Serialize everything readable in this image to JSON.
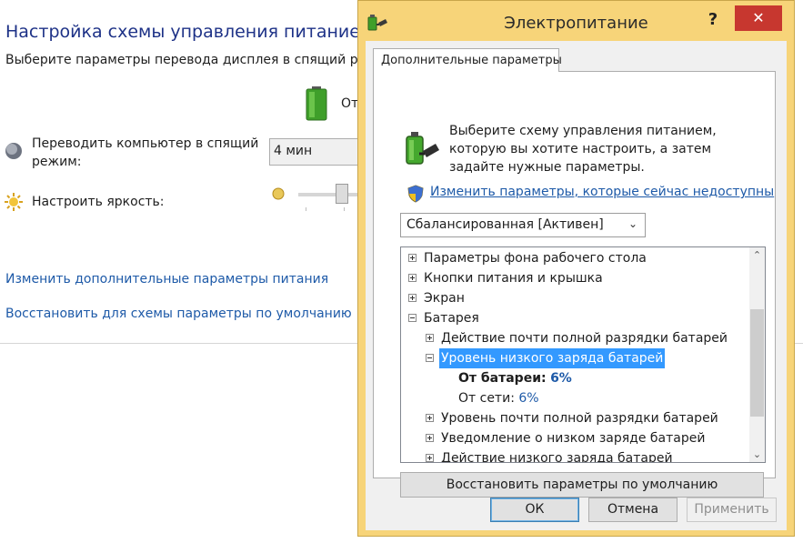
{
  "background": {
    "title": "Настройка схемы управления питанием \"С",
    "subtitle": "Выберите параметры перевода дисплея в спящий реж",
    "plan_column_label": "От",
    "sleep_label": "Переводить компьютер в спящий режим:",
    "sleep_value": "4 мин",
    "brightness_label": "Настроить яркость:",
    "brightness_level_fraction": 0.6,
    "link_advanced": "Изменить дополнительные параметры питания",
    "link_restore": "Восстановить для схемы параметры по умолчанию"
  },
  "dialog": {
    "title": "Электропитание",
    "help_label": "?",
    "close_label": "✕",
    "tab_label": "Дополнительные параметры",
    "description": "Выберите схему управления питанием, которую вы хотите настроить, а затем задайте нужные параметры.",
    "admin_link": "Изменить параметры, которые сейчас недоступны",
    "plan_select_value": "Сбалансированная [Активен]",
    "tree": {
      "item_desktop_bg": "Параметры фона рабочего стола",
      "item_power_buttons": "Кнопки питания и крышка",
      "item_display": "Экран",
      "item_battery": "Батарея",
      "item_critical_action": "Действие почти полной разрядки батарей",
      "item_low_level": "Уровень низкого заряда батарей",
      "on_battery_label": "От батареи:",
      "on_battery_value": "6%",
      "plugged_in_label": "От сети:",
      "plugged_in_value": "6%",
      "item_critical_level": "Уровень почти полной разрядки батарей",
      "item_low_notification": "Уведомление о низком заряде батарей",
      "item_low_action": "Действие низкого заряда батарей"
    },
    "restore_defaults": "Восстановить параметры по умолчанию",
    "ok": "ОК",
    "cancel": "Отмена",
    "apply": "Применить"
  },
  "icons": {
    "battery": "battery-icon",
    "moon": "sleep-moon-icon",
    "sun": "brightness-sun-icon",
    "power_options": "power-options-icon",
    "shield": "uac-shield-icon"
  },
  "colors": {
    "dialog_frame": "#f7d479",
    "close_button": "#c7372f",
    "link": "#1e5aa8",
    "selection": "#3399ff"
  }
}
